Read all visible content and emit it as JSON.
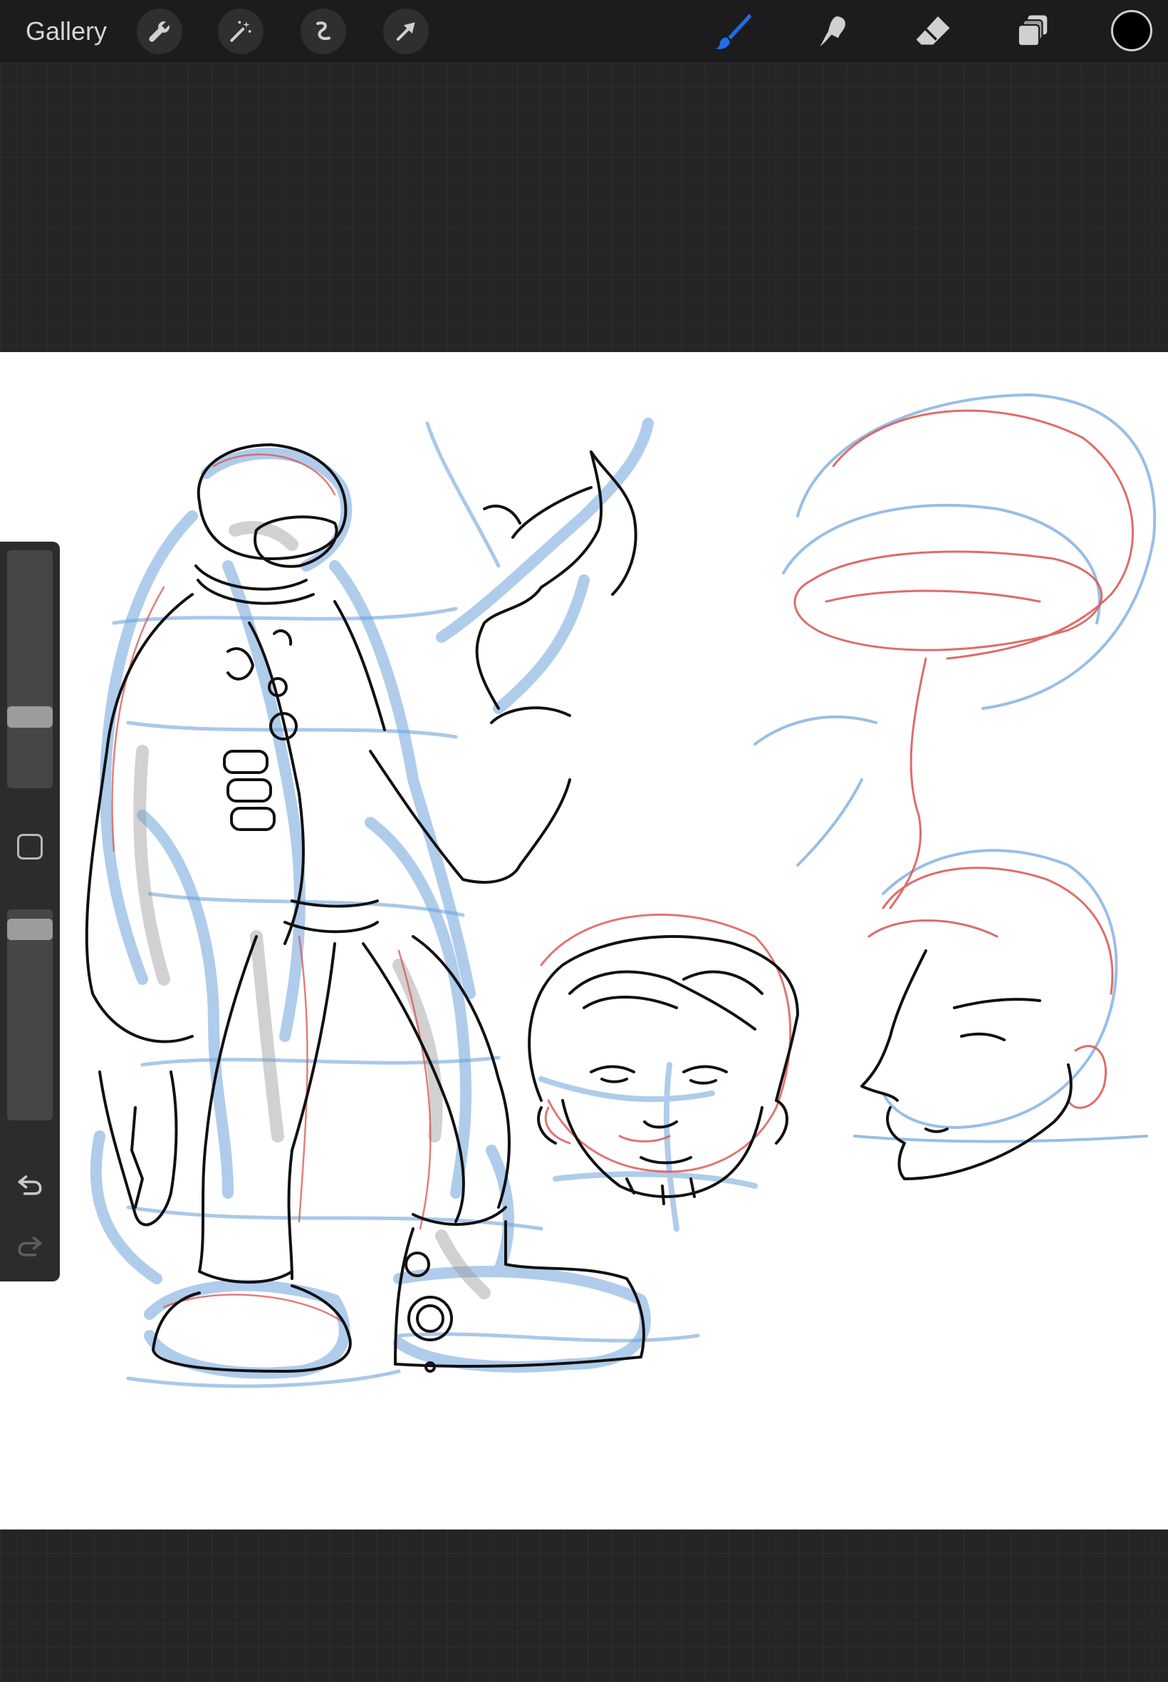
{
  "topbar": {
    "gallery_label": "Gallery",
    "left_tools": [
      "wrench-icon",
      "magic-wand-icon",
      "selection-icon",
      "transform-arrow-icon"
    ],
    "right_tools": [
      "brush-icon",
      "smudge-icon",
      "eraser-icon",
      "layers-icon"
    ],
    "active_tool": "brush",
    "active_color": "#000000",
    "accent_color": "#1e6ee6"
  },
  "sidebar": {
    "brush_size_level": 0.28,
    "opacity_level": 0.95,
    "undo_icon": "undo-icon",
    "redo_icon": "redo-icon",
    "modifier_icon": "modifier-square-icon"
  },
  "canvas": {
    "background": "#ffffff",
    "sketch_colors": {
      "sketch_blue": "#6fa3dc",
      "sketch_red": "#d9534f",
      "ink": "#111111",
      "shading": "#9a9a9a"
    }
  }
}
